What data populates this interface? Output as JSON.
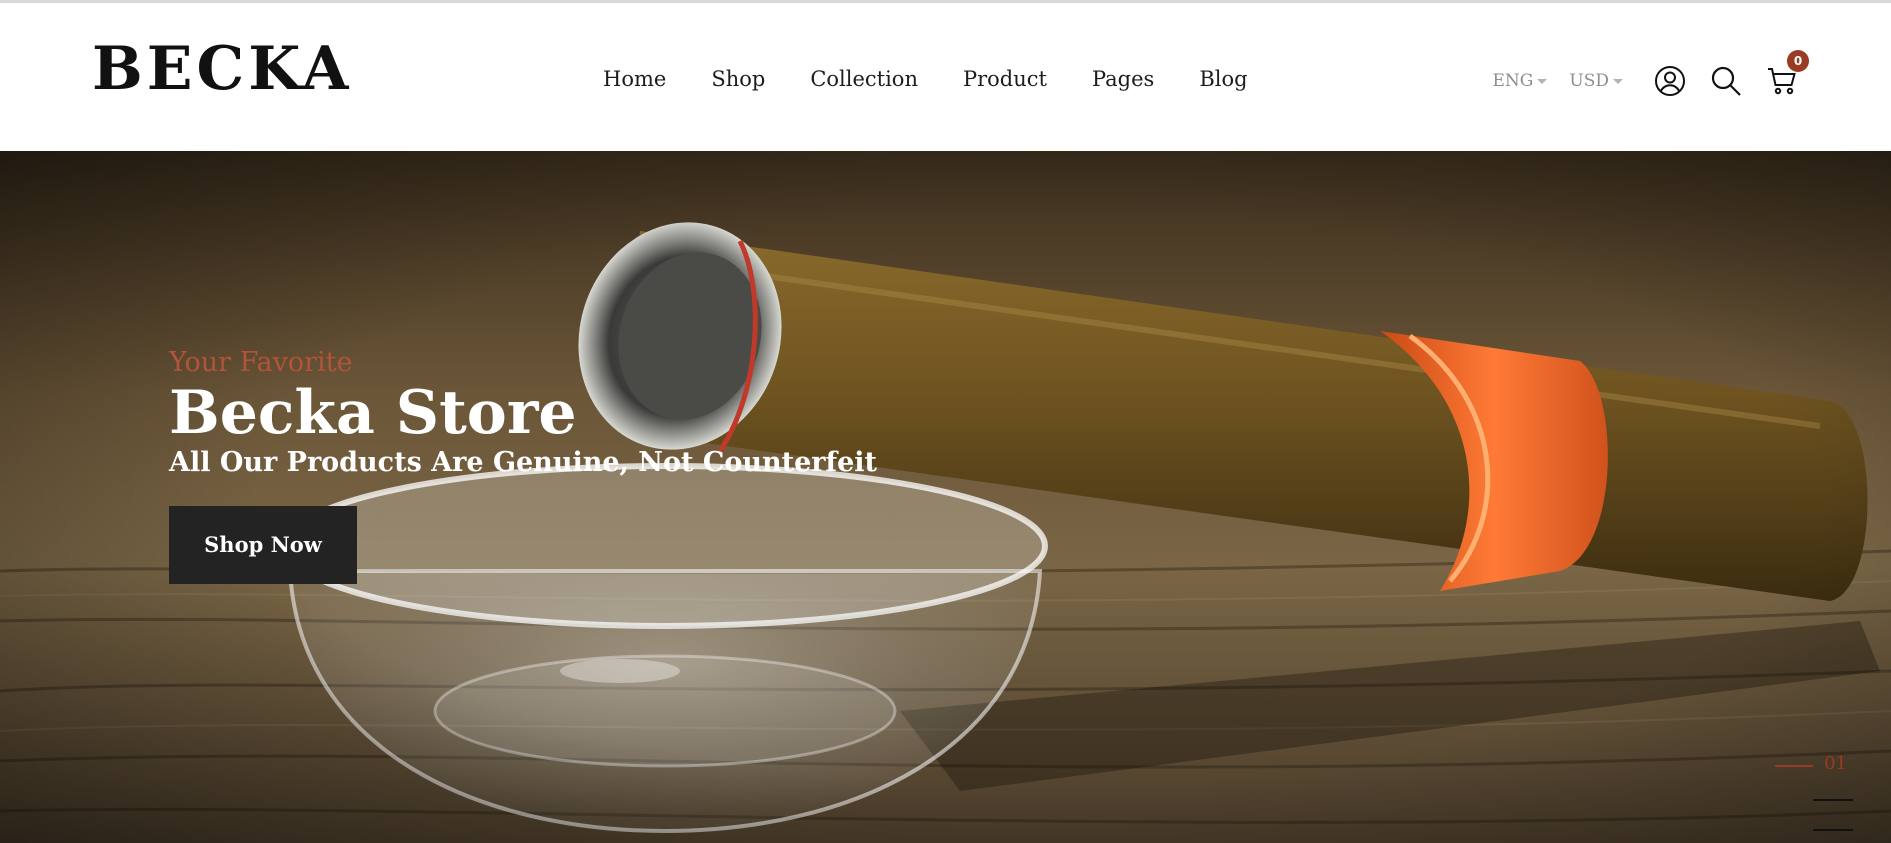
{
  "brand": {
    "logo": "BECKA"
  },
  "nav": {
    "items": [
      {
        "label": "Home"
      },
      {
        "label": "Shop"
      },
      {
        "label": "Collection"
      },
      {
        "label": "Product"
      },
      {
        "label": "Pages"
      },
      {
        "label": "Blog"
      }
    ]
  },
  "tools": {
    "language": "ENG",
    "currency": "USD",
    "account_icon": "user-circle-icon",
    "search_icon": "search-icon",
    "cart_icon": "cart-icon",
    "cart_count": "0"
  },
  "hero": {
    "eyebrow": "Your Favorite",
    "title": "Becka Store",
    "subtitle": "All Our Products Are Genuine, Not Counterfeit",
    "cta_label": "Shop Now",
    "slide_number": "01"
  },
  "colors": {
    "accent": "#9a3b23",
    "eyebrow": "#b2543a",
    "button_bg": "#232323",
    "cigar_band": "#e8622a"
  }
}
